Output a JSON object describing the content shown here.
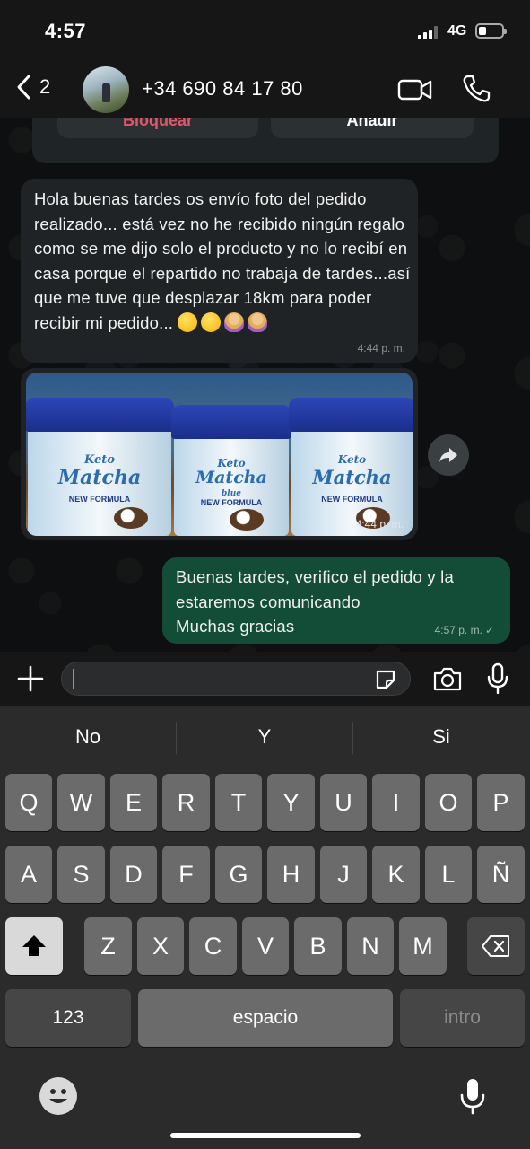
{
  "status_bar": {
    "time": "4:57",
    "network": "4G",
    "signal_bars": 3,
    "battery_level": 0.35
  },
  "header": {
    "back_count": "2",
    "contact_name": "+34 690 84 17 80",
    "icons": [
      "chevron-left-icon",
      "video-call-icon",
      "phone-icon"
    ]
  },
  "top_actions": {
    "block_label": "Bloquear",
    "add_label": "Añadir"
  },
  "messages": [
    {
      "direction": "incoming",
      "type": "text",
      "text": "Hola buenas tardes os envío foto del pedido realizado... está vez no he recibido ningún regalo como se me dijo solo el producto y no lo recibí en casa porque el repartido no trabaja de tardes...así que me tuve que desplazar 18km para poder recibir mi pedido...",
      "emoji": [
        "confused-face",
        "confused-face",
        "woman-gesturing-no",
        "woman-gesturing-no"
      ],
      "time": "4:44 p. m."
    },
    {
      "direction": "incoming",
      "type": "image",
      "image_label": {
        "brand_prefix": "Keto",
        "brand": "Matcha",
        "brand_suffix": "blue",
        "formula": "NEW FORMULA"
      },
      "time": "4:44 p. m."
    },
    {
      "direction": "outgoing",
      "type": "text",
      "lines": [
        "Buenas tardes, verifico el pedido y la",
        "estaremos comunicando",
        "Muchas gracias"
      ],
      "time": "4:57 p. m.",
      "status": "✓"
    }
  ],
  "composer": {
    "value": "",
    "icons": [
      "plus-icon",
      "sticker-icon",
      "camera-icon",
      "microphone-icon"
    ]
  },
  "keyboard": {
    "suggestions": [
      "No",
      "Y",
      "Si"
    ],
    "row1": [
      "Q",
      "W",
      "E",
      "R",
      "T",
      "Y",
      "U",
      "I",
      "O",
      "P"
    ],
    "row2": [
      "A",
      "S",
      "D",
      "F",
      "G",
      "H",
      "J",
      "K",
      "L",
      "Ñ"
    ],
    "row3": [
      "Z",
      "X",
      "C",
      "V",
      "B",
      "N",
      "M"
    ],
    "numbers_label": "123",
    "space_label": "espacio",
    "return_label": "intro"
  },
  "colors": {
    "incoming_bubble": "#1f2325",
    "outgoing_bubble": "#134d37",
    "accent": "#25d366",
    "block_text": "#e0566a"
  }
}
